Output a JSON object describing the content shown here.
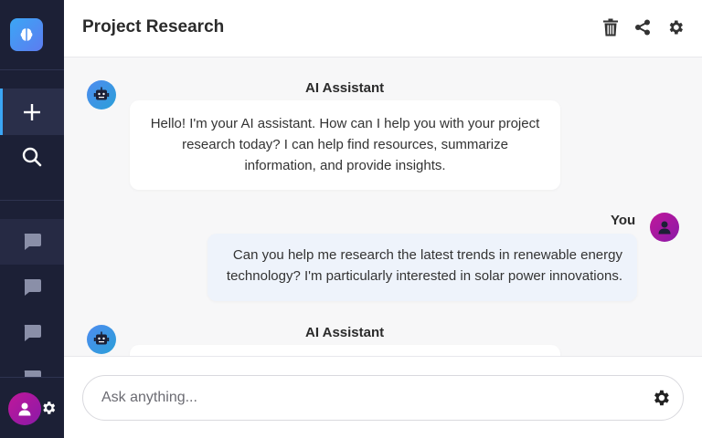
{
  "header": {
    "title": "Project Research"
  },
  "sidebar": {
    "logo_icon": "brain-icon",
    "new_chat_icon": "plus-icon",
    "search_icon": "search-icon",
    "chat_icon": "chat-bubble-icon",
    "settings_icon": "gear-icon"
  },
  "toolbar": {
    "delete_icon": "trash-icon",
    "share_icon": "share-icon",
    "settings_icon": "gear-icon"
  },
  "messages": [
    {
      "sender": "AI Assistant",
      "role": "assistant",
      "text": "Hello! I'm your AI assistant. How can I help you with your project research today? I can help find resources, summarize information, and provide insights."
    },
    {
      "sender": "You",
      "role": "user",
      "text": "Can you help me research the latest trends in renewable energy technology? I'm particularly interested in solar power innovations."
    },
    {
      "sender": "AI Assistant",
      "role": "assistant",
      "text": ""
    }
  ],
  "composer": {
    "placeholder": "Ask anything...",
    "value": ""
  },
  "colors": {
    "sidebar": "#1c2036",
    "accent": "#3ba6f5",
    "user_avatar": "#c0179a",
    "bot_avatar": "#4f8cf0"
  }
}
